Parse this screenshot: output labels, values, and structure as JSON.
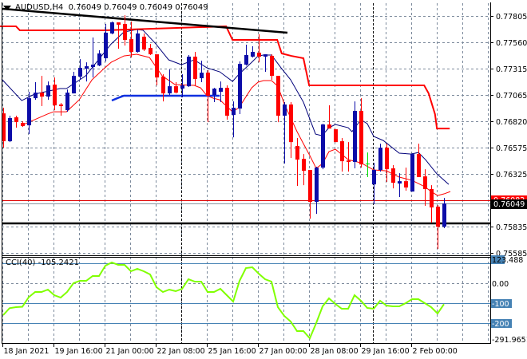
{
  "title": {
    "symbol": "AUDUSD,H4",
    "ohlc": "0.76049 0.76049 0.76049 0.76049"
  },
  "colors": {
    "bull": "#0c0ca8",
    "bear": "#ff0000",
    "doji": "#00e000",
    "grid": "#7c8a9c",
    "cci": "#80ff00",
    "cci_levels": "#4682b4",
    "ma_upper": "#00007a",
    "ma_lower": "#ff0000",
    "resistance_step": "#ff0000",
    "trendline": "#000000",
    "support_short": "#1030e0"
  },
  "cci": {
    "label": "CCI(40) -105.2421"
  },
  "chart_data": {
    "type": "candlestick",
    "symbol": "AUDUSD",
    "timeframe": "H4",
    "y_ticks": [
      "0.77805",
      "0.77560",
      "0.77315",
      "0.77065",
      "0.76820",
      "0.76575",
      "0.76325",
      "0.75835",
      "0.75585"
    ],
    "current_price": "0.76049",
    "red_line_price": "0.76082",
    "support_line_price": 0.75862,
    "x_ticks": [
      {
        "bar": 0,
        "label": "18 Jan 2021"
      },
      {
        "bar": 8,
        "label": "19 Jan 16:00"
      },
      {
        "bar": 16,
        "label": "21 Jan 00:00"
      },
      {
        "bar": 24,
        "label": "22 Jan 08:00"
      },
      {
        "bar": 32,
        "label": "25 Jan 16:00"
      },
      {
        "bar": 40,
        "label": "27 Jan 00:00"
      },
      {
        "bar": 48,
        "label": "28 Jan 08:00"
      },
      {
        "bar": 56,
        "label": "29 Jan 16:00"
      },
      {
        "bar": 64,
        "label": "2 Feb 00:00"
      }
    ],
    "period_separators": [
      28,
      58
    ],
    "candles_ohlc": [
      [
        0.76893,
        0.76946,
        0.76572,
        0.76632
      ],
      [
        0.76632,
        0.76871,
        0.76624,
        0.76849
      ],
      [
        0.76856,
        0.76871,
        0.76759,
        0.76811
      ],
      [
        0.76804,
        0.76819,
        0.76766,
        0.76774
      ],
      [
        0.76781,
        0.77095,
        0.76699,
        0.77035
      ],
      [
        0.77035,
        0.77185,
        0.7702,
        0.77087
      ],
      [
        0.77087,
        0.77244,
        0.76961,
        0.7705
      ],
      [
        0.7705,
        0.77192,
        0.7702,
        0.77155
      ],
      [
        0.77162,
        0.77229,
        0.76923,
        0.76968
      ],
      [
        0.76976,
        0.7699,
        0.76871,
        0.76961
      ],
      [
        0.76923,
        0.77117,
        0.76908,
        0.77087
      ],
      [
        0.7708,
        0.77282,
        0.7708,
        0.77244
      ],
      [
        0.77237,
        0.77401,
        0.77207,
        0.77319
      ],
      [
        0.77312,
        0.77371,
        0.77192,
        0.77334
      ],
      [
        0.77327,
        0.77603,
        0.77229,
        0.77349
      ],
      [
        0.77341,
        0.77484,
        0.77334,
        0.77454
      ],
      [
        0.77409,
        0.7773,
        0.77379,
        0.77648
      ],
      [
        0.77641,
        0.77753,
        0.77633,
        0.77745
      ],
      [
        0.77745,
        0.77745,
        0.77498,
        0.77723
      ],
      [
        0.7773,
        0.77812,
        0.77528,
        0.77581
      ],
      [
        0.77588,
        0.77753,
        0.77416,
        0.77469
      ],
      [
        0.77469,
        0.77678,
        0.77461,
        0.77641
      ],
      [
        0.77611,
        0.77641,
        0.77476,
        0.77491
      ],
      [
        0.77506,
        0.77543,
        0.77439,
        0.77446
      ],
      [
        0.77446,
        0.77446,
        0.77155,
        0.77229
      ],
      [
        0.77237,
        0.77259,
        0.77005,
        0.7708
      ],
      [
        0.7708,
        0.77304,
        0.77065,
        0.77147
      ],
      [
        0.77147,
        0.77185,
        0.7708,
        0.77087
      ],
      [
        0.77125,
        0.77259,
        0.77043,
        0.77155
      ],
      [
        0.77147,
        0.77439,
        0.7714,
        0.77424
      ],
      [
        0.77424,
        0.77469,
        0.77155,
        0.77215
      ],
      [
        0.77222,
        0.77386,
        0.77185,
        0.77274
      ],
      [
        0.77274,
        0.77297,
        0.76811,
        0.77058
      ],
      [
        0.77065,
        0.77132,
        0.76998,
        0.77125
      ],
      [
        0.77095,
        0.77192,
        0.76998,
        0.77132
      ],
      [
        0.77132,
        0.77155,
        0.76834,
        0.76871
      ],
      [
        0.76878,
        0.77005,
        0.76669,
        0.76946
      ],
      [
        0.76938,
        0.77379,
        0.76886,
        0.77356
      ],
      [
        0.77349,
        0.77536,
        0.77341,
        0.77439
      ],
      [
        0.77424,
        0.77521,
        0.77416,
        0.77469
      ],
      [
        0.77461,
        0.77633,
        0.77371,
        0.77424
      ],
      [
        0.77424,
        0.77446,
        0.77282,
        0.77446
      ],
      [
        0.77431,
        0.77446,
        0.77207,
        0.77244
      ],
      [
        0.77244,
        0.77244,
        0.76811,
        0.76871
      ],
      [
        0.76871,
        0.76998,
        0.76423,
        0.76976
      ],
      [
        0.76976,
        0.76998,
        0.76475,
        0.76624
      ],
      [
        0.76587,
        0.76662,
        0.76214,
        0.7646
      ],
      [
        0.76467,
        0.76512,
        0.76221,
        0.76355
      ],
      [
        0.76363,
        0.76363,
        0.75907,
        0.76064
      ],
      [
        0.76064,
        0.76393,
        0.75952,
        0.76385
      ],
      [
        0.76385,
        0.76796,
        0.7637,
        0.76789
      ],
      [
        0.76789,
        0.76968,
        0.76751,
        0.76751
      ],
      [
        0.76744,
        0.76744,
        0.76624,
        0.76624
      ],
      [
        0.76632,
        0.76662,
        0.76348,
        0.76445
      ],
      [
        0.76452,
        0.76624,
        0.76348,
        0.76438
      ],
      [
        0.76438,
        0.77005,
        0.76378,
        0.76916
      ],
      [
        0.76916,
        0.77035,
        0.76385,
        0.76415
      ],
      [
        0.76423,
        0.76527,
        0.76296,
        0.76423
      ],
      [
        0.76228,
        0.7643,
        0.76042,
        0.76363
      ],
      [
        0.76363,
        0.76609,
        0.76348,
        0.76572
      ],
      [
        0.76572,
        0.76609,
        0.76251,
        0.7637
      ],
      [
        0.76378,
        0.76408,
        0.76191,
        0.76243
      ],
      [
        0.76236,
        0.76333,
        0.76109,
        0.76258
      ],
      [
        0.76258,
        0.76385,
        0.76169,
        0.76199
      ],
      [
        0.76161,
        0.7652,
        0.76161,
        0.76512
      ],
      [
        0.76512,
        0.76609,
        0.76296,
        0.76296
      ],
      [
        0.76303,
        0.7637,
        0.76027,
        0.76184
      ],
      [
        0.76184,
        0.76221,
        0.75869,
        0.76012
      ],
      [
        0.76019,
        0.76034,
        0.75624,
        0.75832
      ],
      [
        0.75832,
        0.76101,
        0.75818,
        0.76049
      ]
    ],
    "ma_upper": [
      [
        -0.25,
        0.77215
      ],
      [
        2.9,
        0.77013
      ],
      [
        4.9,
        0.77073
      ],
      [
        8.9,
        0.77125
      ],
      [
        9.9,
        0.77125
      ],
      [
        12.9,
        0.77244
      ],
      [
        14.9,
        0.77394
      ],
      [
        16.9,
        0.77543
      ],
      [
        18.9,
        0.77655
      ],
      [
        20.9,
        0.77678
      ],
      [
        21.9,
        0.77671
      ],
      [
        23.9,
        0.77543
      ],
      [
        25.9,
        0.77394
      ],
      [
        27.9,
        0.77349
      ],
      [
        29.9,
        0.77394
      ],
      [
        31.9,
        0.77319
      ],
      [
        33.9,
        0.77282
      ],
      [
        35.9,
        0.77192
      ],
      [
        36.9,
        0.77259
      ],
      [
        38.9,
        0.77371
      ],
      [
        39.9,
        0.77431
      ],
      [
        40.75,
        0.77439
      ],
      [
        42,
        0.77439
      ],
      [
        43.5,
        0.77319
      ],
      [
        45,
        0.77207
      ],
      [
        47,
        0.76998
      ],
      [
        48.9,
        0.76699
      ],
      [
        49.9,
        0.76684
      ],
      [
        51,
        0.76759
      ],
      [
        52,
        0.76789
      ],
      [
        54,
        0.76759
      ],
      [
        54.6,
        0.76722
      ],
      [
        56,
        0.76834
      ],
      [
        57,
        0.76796
      ],
      [
        58,
        0.76677
      ],
      [
        59.5,
        0.76639
      ],
      [
        62,
        0.7652
      ],
      [
        63.9,
        0.76512
      ],
      [
        65,
        0.76527
      ],
      [
        66.1,
        0.7646
      ],
      [
        67.9,
        0.76326
      ],
      [
        69.75,
        0.76228
      ]
    ],
    "ma_lower": [
      [
        2.9,
        0.76781
      ],
      [
        6.9,
        0.76886
      ],
      [
        7.9,
        0.76908
      ],
      [
        9.9,
        0.76908
      ],
      [
        11.9,
        0.7702
      ],
      [
        13.9,
        0.77207
      ],
      [
        15.9,
        0.77319
      ],
      [
        16.9,
        0.77371
      ],
      [
        18.9,
        0.77431
      ],
      [
        20.9,
        0.77446
      ],
      [
        22.9,
        0.77416
      ],
      [
        24.9,
        0.77244
      ],
      [
        26.9,
        0.77162
      ],
      [
        29.9,
        0.77155
      ],
      [
        30.9,
        0.77132
      ],
      [
        31.9,
        0.77058
      ],
      [
        32.9,
        0.77035
      ],
      [
        33.9,
        0.7702
      ],
      [
        35.9,
        0.76908
      ],
      [
        36.9,
        0.76946
      ],
      [
        38.9,
        0.77132
      ],
      [
        39.9,
        0.77185
      ],
      [
        40.75,
        0.772
      ],
      [
        42,
        0.772
      ],
      [
        43,
        0.77147
      ],
      [
        44,
        0.76983
      ],
      [
        46,
        0.76722
      ],
      [
        47,
        0.76609
      ],
      [
        48,
        0.76498
      ],
      [
        49,
        0.76378
      ],
      [
        50,
        0.76423
      ],
      [
        51,
        0.76535
      ],
      [
        52,
        0.76557
      ],
      [
        54,
        0.7646
      ],
      [
        56,
        0.7643
      ],
      [
        58,
        0.76363
      ],
      [
        60,
        0.76355
      ],
      [
        62,
        0.76296
      ],
      [
        64,
        0.76266
      ],
      [
        66,
        0.76206
      ],
      [
        67,
        0.76161
      ],
      [
        68,
        0.76124
      ],
      [
        69,
        0.76139
      ],
      [
        70,
        0.76161
      ]
    ],
    "resistance_step": [
      [
        -0.5,
        0.77708
      ],
      [
        2,
        0.77708
      ],
      [
        2.6,
        0.77671
      ],
      [
        15.9,
        0.77671
      ],
      [
        34.9,
        0.77708
      ],
      [
        35.9,
        0.77581
      ],
      [
        42.9,
        0.77581
      ],
      [
        43.6,
        0.77454
      ],
      [
        45.1,
        0.77431
      ],
      [
        47,
        0.77409
      ],
      [
        47.9,
        0.77155
      ],
      [
        65.9,
        0.77155
      ],
      [
        66.6,
        0.7708
      ],
      [
        67.6,
        0.76886
      ],
      [
        67.9,
        0.76751
      ],
      [
        69.9,
        0.76751
      ]
    ],
    "trendline": [
      [
        -0.1,
        0.77872
      ],
      [
        44.5,
        0.77648
      ]
    ],
    "support_short": [
      [
        17,
        0.77013
      ],
      [
        18.2,
        0.77043
      ],
      [
        18.9,
        0.77058
      ],
      [
        33.9,
        0.77058
      ]
    ],
    "cci_axis_labels": [
      "123.488",
      "0.00",
      "-100",
      "-200",
      "-291.9651"
    ],
    "cci_levels": [
      100,
      0,
      -100,
      -200
    ],
    "cci_values": [
      -160,
      -125,
      -120,
      -118,
      -70,
      -44,
      -44,
      -32,
      -60,
      -72,
      -44,
      0,
      12,
      12,
      36,
      36,
      88,
      104,
      92,
      92,
      60,
      72,
      60,
      44,
      -20,
      -44,
      -32,
      -40,
      -28,
      20,
      8,
      8,
      -44,
      -44,
      -28,
      -60,
      -92,
      12,
      76,
      80,
      48,
      20,
      8,
      -120,
      -164,
      -192,
      -240,
      -240,
      -276,
      -200,
      -116,
      -76,
      -104,
      -128,
      -128,
      -60,
      -88,
      -124,
      -128,
      -88,
      -112,
      -116,
      -116,
      -100,
      -80,
      -80,
      -100,
      -120,
      -152,
      -105.2421
    ]
  }
}
